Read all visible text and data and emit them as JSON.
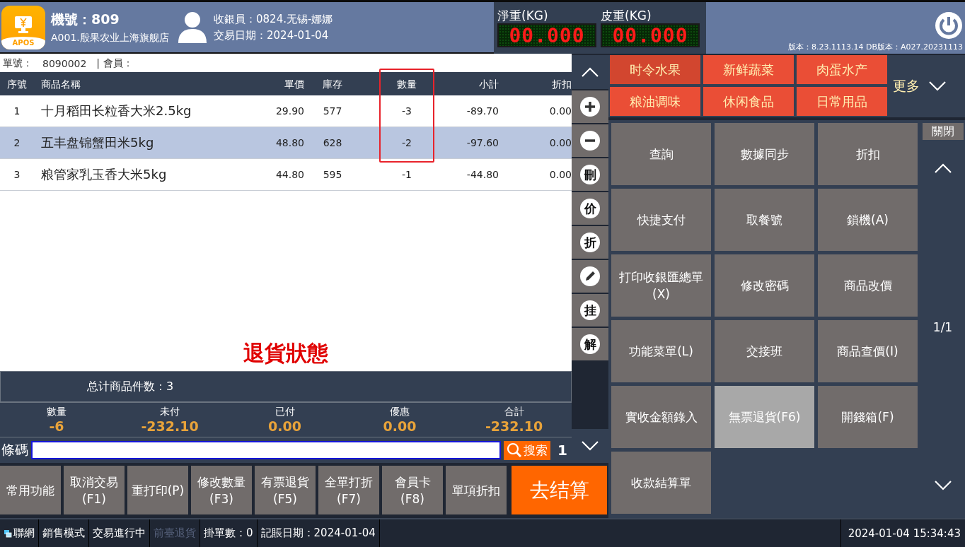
{
  "header": {
    "logo_text": "APOS",
    "machine": "機號：809",
    "store": "A001.殷果农业上海旗舰店",
    "cashier": "收銀員：0824.无锡-娜娜",
    "trade_date": "交易日期：2024-01-04",
    "scales": [
      {
        "label": "淨重(KG)",
        "reading": "00.000"
      },
      {
        "label": "皮重(KG)",
        "reading": "00.000"
      }
    ],
    "version": "版本：8.23.1113.14 DB版本：A027.20231113"
  },
  "order": {
    "number_label": "單號：",
    "number": "8090002",
    "member_label": "| 會員："
  },
  "table": {
    "columns": [
      {
        "label": "序號",
        "highlighted": false
      },
      {
        "label": "商品名稱",
        "highlighted": false
      },
      {
        "label": "單價",
        "highlighted": false
      },
      {
        "label": "庫存",
        "highlighted": false
      },
      {
        "label": "數量",
        "highlighted": true
      },
      {
        "label": "小計",
        "highlighted": false
      },
      {
        "label": "折扣",
        "highlighted": false
      }
    ],
    "rows": [
      {
        "cells": [
          "1",
          "十月稻田长粒香大米2.5kg",
          "29.90",
          "577",
          "-3",
          "-89.70",
          "0.00"
        ],
        "selected": false
      },
      {
        "cells": [
          "2",
          "五丰盘锦蟹田米5kg",
          "48.80",
          "628",
          "-2",
          "-97.60",
          "0.00"
        ],
        "selected": true
      },
      {
        "cells": [
          "3",
          "粮管家乳玉香大米5kg",
          "44.80",
          "595",
          "-1",
          "-44.80",
          "0.00"
        ],
        "selected": false
      }
    ],
    "mode_text": "退貨狀態",
    "item_count": "总计商品件数：3"
  },
  "totals": [
    {
      "label": "數量",
      "value": "-6"
    },
    {
      "label": "未付",
      "value": "-232.10"
    },
    {
      "label": "已付",
      "value": "0.00"
    },
    {
      "label": "優惠",
      "value": "0.00"
    },
    {
      "label": "合計",
      "value": "-232.10"
    }
  ],
  "barcode": {
    "label": "條碼",
    "search": "搜索",
    "count": "1"
  },
  "side_tools": [
    {
      "kind": "plus"
    },
    {
      "kind": "minus"
    },
    {
      "kind": "char",
      "label": "刪"
    },
    {
      "kind": "char",
      "label": "价"
    },
    {
      "kind": "char",
      "label": "折"
    },
    {
      "kind": "edit"
    },
    {
      "kind": "char",
      "label": "挂"
    },
    {
      "kind": "char",
      "label": "解"
    }
  ],
  "bottom_buttons": [
    {
      "label": "常用功能"
    },
    {
      "label": "取消交易",
      "key": "(F1)"
    },
    {
      "label": "重打印(P)"
    },
    {
      "label": "修改數量",
      "key": "(F3)"
    },
    {
      "label": "有票退貨",
      "key": "(F5)"
    },
    {
      "label": "全單打折",
      "key": "(F7)"
    },
    {
      "label": "會員卡",
      "key": "(F8)"
    },
    {
      "label": "單項折扣"
    }
  ],
  "checkout": "去结算",
  "categories": [
    {
      "label": "时令水果",
      "selected": true
    },
    {
      "label": "新鲜蔬菜",
      "selected": false
    },
    {
      "label": "肉蛋水产",
      "selected": false
    },
    {
      "label": "粮油调味",
      "selected": false
    },
    {
      "label": "休闲食品",
      "selected": false
    },
    {
      "label": "日常用品",
      "selected": false
    }
  ],
  "more": "更多",
  "functions": [
    {
      "label": "查詢",
      "selected": false
    },
    {
      "label": "數據同步",
      "selected": false
    },
    {
      "label": "折扣",
      "selected": false
    },
    {
      "label": "快捷支付",
      "selected": false
    },
    {
      "label": "取餐號",
      "selected": false
    },
    {
      "label": "鎖機(A)",
      "selected": false
    },
    {
      "label": "打印收銀匯總單(X)",
      "selected": false
    },
    {
      "label": "修改密碼",
      "selected": false
    },
    {
      "label": "商品改價",
      "selected": false
    },
    {
      "label": "功能菜單(L)",
      "selected": false
    },
    {
      "label": "交接班",
      "selected": false
    },
    {
      "label": "商品查價(I)",
      "selected": false
    },
    {
      "label": "實收金額錄入",
      "selected": false
    },
    {
      "label": "無票退貨(F6)",
      "selected": true
    },
    {
      "label": "開錢箱(F)",
      "selected": false
    },
    {
      "label": "收款結算單",
      "selected": false
    }
  ],
  "close": "關閉",
  "page": "1/1",
  "status_bar": {
    "items": [
      {
        "label": "聯網",
        "kind": "network",
        "disabled": false
      },
      {
        "label": "銷售模式",
        "kind": "text",
        "disabled": false
      },
      {
        "label": "交易進行中",
        "kind": "text",
        "disabled": false
      },
      {
        "label": "前臺退貨",
        "kind": "text",
        "disabled": true
      },
      {
        "label": "掛單數：0",
        "kind": "text",
        "disabled": false
      },
      {
        "label": "記賬日期：2024-01-04",
        "kind": "text",
        "disabled": false
      }
    ],
    "clock": "2024-01-04 15:34:43"
  }
}
